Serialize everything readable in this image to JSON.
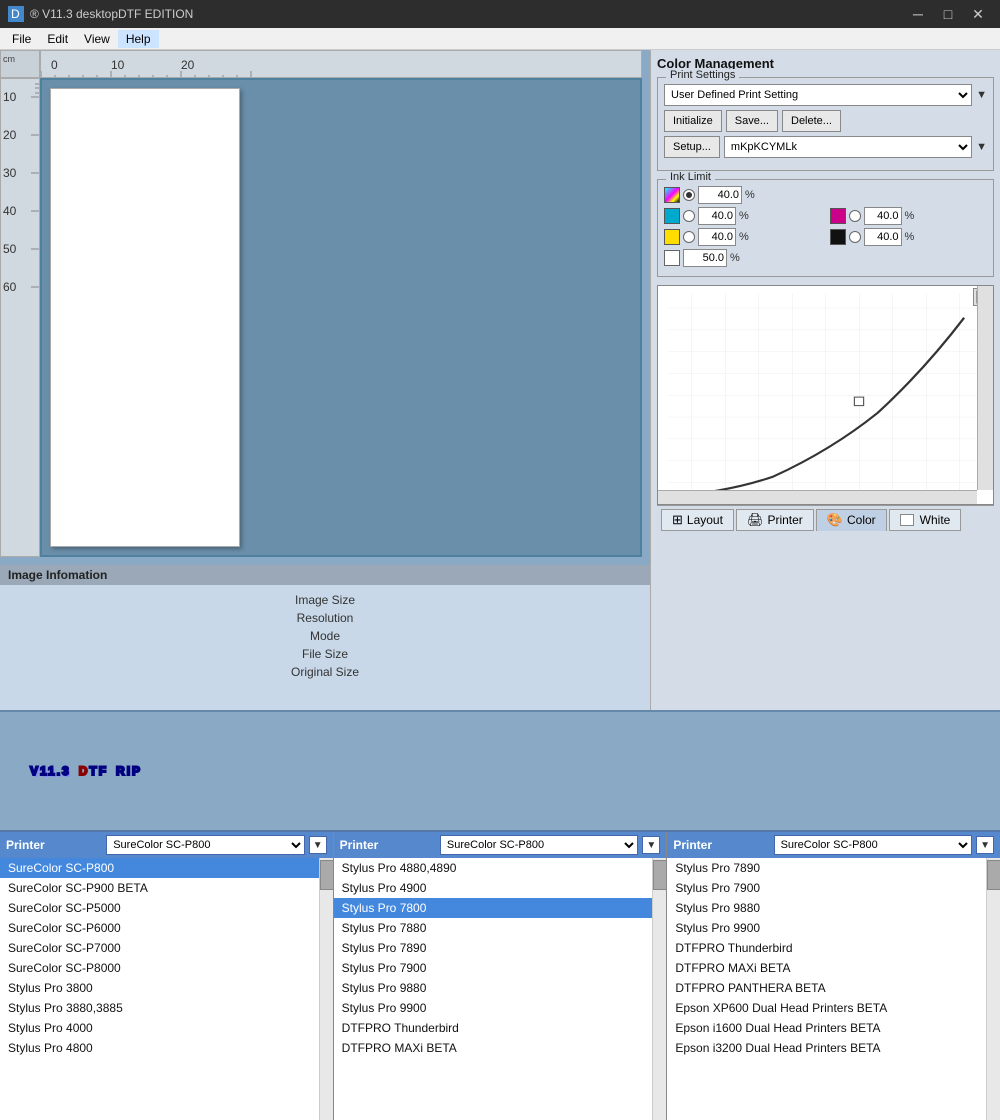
{
  "titleBar": {
    "appName": "® V11.3 desktopDTF EDITION",
    "minBtn": "─",
    "maxBtn": "□",
    "closeBtn": "✕"
  },
  "menuBar": {
    "items": [
      "File",
      "Edit",
      "View",
      "Help"
    ]
  },
  "ruler": {
    "unit": "cm",
    "marks": [
      "0",
      "10",
      "20"
    ]
  },
  "imageInfo": {
    "title": "Image Infomation",
    "rows": [
      "Image Size",
      "Resolution",
      "Mode",
      "File Size",
      "Original Size"
    ]
  },
  "colorManagement": {
    "title": "Color Management",
    "printSettings": {
      "groupTitle": "Print Settings",
      "currentSetting": "User Defined Print Setting",
      "initBtn": "Initialize",
      "saveBtn": "Save...",
      "deleteBtn": "Delete...",
      "setupBtn": "Setup...",
      "setupValue": "mKpKCYMLk"
    },
    "inkLimit": {
      "groupTitle": "Ink Limit",
      "totalValue": "40.0",
      "cyanValue": "40.0",
      "magentaValue": "40.0",
      "yellowValue": "40.0",
      "blackValue": "40.0",
      "whiteValue": "50.0",
      "pctLabel": "%"
    }
  },
  "bottomTabs": {
    "tabs": [
      "Layout",
      "Printer",
      "Color",
      "White"
    ]
  },
  "bigText": "V11.3 DTF RIP",
  "printerDropdowns": [
    {
      "label": "Printer",
      "selected": "SureColor SC-P800",
      "items": [
        "SureColor SC-P800",
        "SureColor SC-P900 BETA",
        "SureColor SC-P5000",
        "SureColor SC-P6000",
        "SureColor SC-P7000",
        "SureColor SC-P8000",
        "Stylus Pro 3800",
        "Stylus Pro 3880,3885",
        "Stylus Pro 4000",
        "Stylus Pro 4800"
      ],
      "selectedIndex": 0
    },
    {
      "label": "Printer",
      "selected": "SureColor SC-P800",
      "items": [
        "Stylus Pro 4880,4890",
        "Stylus Pro 4900",
        "Stylus Pro 7800",
        "Stylus Pro 7880",
        "Stylus Pro 7890",
        "Stylus Pro 7900",
        "Stylus Pro 9880",
        "Stylus Pro 9900",
        "DTFPRO Thunderbird",
        "DTFPRO MAXi BETA"
      ],
      "selectedIndex": 2
    },
    {
      "label": "Printer",
      "selected": "SureColor SC-P800",
      "items": [
        "Stylus Pro 7890",
        "Stylus Pro 7900",
        "Stylus Pro 9880",
        "Stylus Pro 9900",
        "DTFPRO Thunderbird",
        "DTFPRO MAXi BETA",
        "DTFPRO PANTHERA BETA",
        "Epson XP600 Dual Head Printers BETA",
        "Epson i1600 Dual Head Printers BETA",
        "Epson i3200 Dual Head Printers BETA"
      ],
      "selectedIndex": -1
    }
  ]
}
